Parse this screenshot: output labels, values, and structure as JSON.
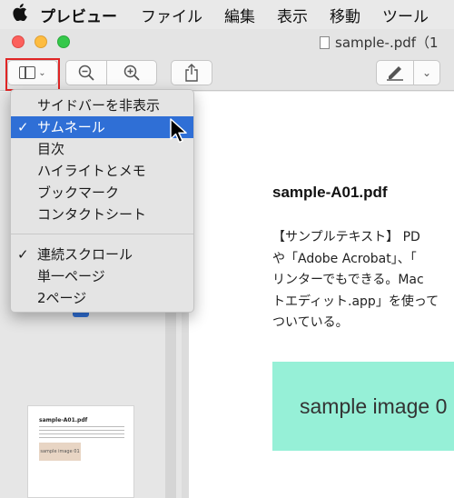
{
  "menubar": {
    "apple_icon": "apple-logo",
    "app_name": "プレビュー",
    "items": [
      "ファイル",
      "編集",
      "表示",
      "移動",
      "ツール"
    ]
  },
  "window": {
    "title": "sample-.pdf（1"
  },
  "toolbar": {
    "sidebar_button_icon": "sidebar-icon",
    "zoom_out_icon": "zoom-out-icon",
    "zoom_in_icon": "zoom-in-icon",
    "share_icon": "share-icon",
    "markup_icon": "pen-icon"
  },
  "sidebar_menu": {
    "items": [
      {
        "label": "サイドバーを非表示",
        "checked": false,
        "highlighted": false
      },
      {
        "label": "サムネール",
        "checked": true,
        "highlighted": true
      },
      {
        "label": "目次",
        "checked": false,
        "highlighted": false
      },
      {
        "label": "ハイライトとメモ",
        "checked": false,
        "highlighted": false
      },
      {
        "label": "ブックマーク",
        "checked": false,
        "highlighted": false
      },
      {
        "label": "コンタクトシート",
        "checked": false,
        "highlighted": false
      }
    ],
    "scroll_items": [
      {
        "label": "連続スクロール",
        "checked": true
      },
      {
        "label": "単一ページ",
        "checked": false
      },
      {
        "label": "2ページ",
        "checked": false
      }
    ],
    "check_mark": "✓"
  },
  "thumbnail": {
    "title": "sample-A01.pdf",
    "image_label": "sample image 01"
  },
  "document": {
    "heading": "sample-A01.pdf",
    "lines": [
      "【サンプルテキスト】 PD",
      "や「Adobe Acrobat」、「",
      "リンターでもできる。Mac",
      "トエディット.app」を使って",
      "ついている。"
    ],
    "image_label": "sample image 0"
  },
  "colors": {
    "selection": "#2f6fd6",
    "image_bg": "#96f0d7",
    "highlight_outline": "#e02525"
  }
}
